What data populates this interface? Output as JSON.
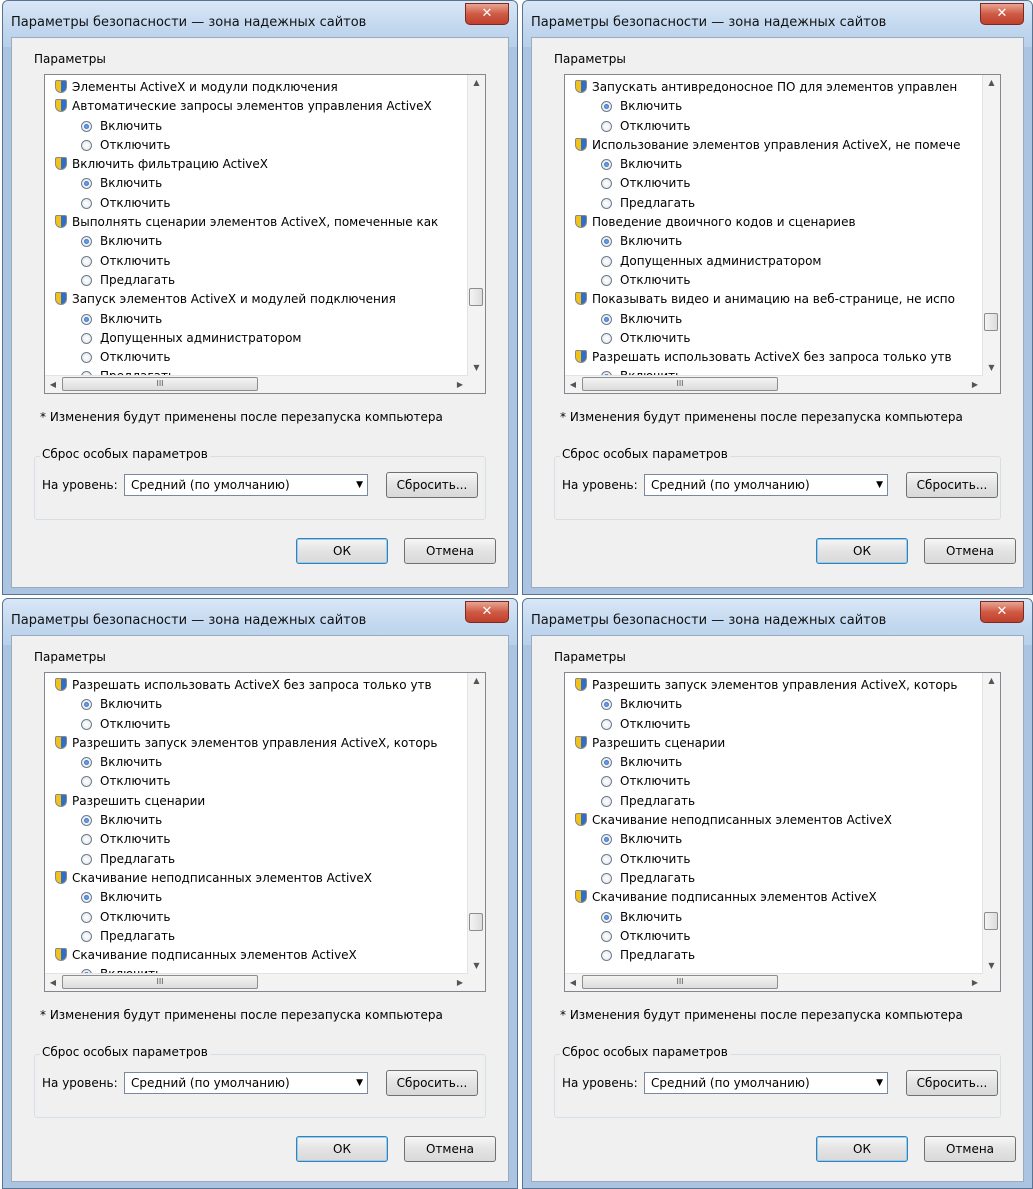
{
  "title": "Параметры безопасности — зона надежных сайтов",
  "close_glyph": "✕",
  "params_label": "Параметры",
  "note": "* Изменения будут применены после перезапуска компьютера",
  "reset_group": "Сброс особых параметров",
  "level_label": "На уровень:",
  "level_value": "Средний (по умолчанию)",
  "reset_button": "Сбросить...",
  "ok_button": "ОК",
  "cancel_button": "Отмена",
  "hscroll_grip": "III",
  "panels": [
    {
      "rows": [
        {
          "t": "h",
          "text": "Элементы ActiveX и модули подключения"
        },
        {
          "t": "h",
          "text": "Автоматические запросы элементов управления ActiveX"
        },
        {
          "t": "o",
          "text": "Включить",
          "on": true
        },
        {
          "t": "o",
          "text": "Отключить",
          "on": false
        },
        {
          "t": "h",
          "text": "Включить фильтрацию ActiveX"
        },
        {
          "t": "o",
          "text": "Включить",
          "on": true
        },
        {
          "t": "o",
          "text": "Отключить",
          "on": false
        },
        {
          "t": "h",
          "text": "Выполнять сценарии элементов ActiveX, помеченные как"
        },
        {
          "t": "o",
          "text": "Включить",
          "on": true
        },
        {
          "t": "o",
          "text": "Отключить",
          "on": false
        },
        {
          "t": "o",
          "text": "Предлагать",
          "on": false
        },
        {
          "t": "h",
          "text": "Запуск элементов ActiveX и модулей подключения"
        },
        {
          "t": "o",
          "text": "Включить",
          "on": true
        },
        {
          "t": "o",
          "text": "Допущенных администратором",
          "on": false
        },
        {
          "t": "o",
          "text": "Отключить",
          "on": false
        },
        {
          "t": "o",
          "text": "Предлагать",
          "on": false
        }
      ]
    },
    {
      "rows": [
        {
          "t": "h",
          "text": "Запускать антивредоносное ПО для элементов управлен"
        },
        {
          "t": "o",
          "text": "Включить",
          "on": true
        },
        {
          "t": "o",
          "text": "Отключить",
          "on": false
        },
        {
          "t": "h",
          "text": "Использование элементов управления ActiveX, не помече"
        },
        {
          "t": "o",
          "text": "Включить",
          "on": true
        },
        {
          "t": "o",
          "text": "Отключить",
          "on": false
        },
        {
          "t": "o",
          "text": "Предлагать",
          "on": false
        },
        {
          "t": "h",
          "text": "Поведение двоичного кодов и сценариев"
        },
        {
          "t": "o",
          "text": "Включить",
          "on": true
        },
        {
          "t": "o",
          "text": "Допущенных администратором",
          "on": false
        },
        {
          "t": "o",
          "text": "Отключить",
          "on": false
        },
        {
          "t": "h",
          "text": "Показывать видео и анимацию на веб-странице, не испо"
        },
        {
          "t": "o",
          "text": "Включить",
          "on": true
        },
        {
          "t": "o",
          "text": "Отключить",
          "on": false
        },
        {
          "t": "h",
          "text": "Разрешать использовать ActiveX без запроса только утв"
        },
        {
          "t": "o",
          "text": "Включить",
          "on": true
        }
      ]
    },
    {
      "rows": [
        {
          "t": "h",
          "text": "Разрешать использовать ActiveX без запроса только утв"
        },
        {
          "t": "o",
          "text": "Включить",
          "on": true
        },
        {
          "t": "o",
          "text": "Отключить",
          "on": false
        },
        {
          "t": "h",
          "text": "Разрешить запуск элементов управления ActiveX, которь"
        },
        {
          "t": "o",
          "text": "Включить",
          "on": true
        },
        {
          "t": "o",
          "text": "Отключить",
          "on": false
        },
        {
          "t": "h",
          "text": "Разрешить сценарии"
        },
        {
          "t": "o",
          "text": "Включить",
          "on": true
        },
        {
          "t": "o",
          "text": "Отключить",
          "on": false
        },
        {
          "t": "o",
          "text": "Предлагать",
          "on": false
        },
        {
          "t": "h",
          "text": "Скачивание неподписанных элементов ActiveX"
        },
        {
          "t": "o",
          "text": "Включить",
          "on": true
        },
        {
          "t": "o",
          "text": "Отключить",
          "on": false
        },
        {
          "t": "o",
          "text": "Предлагать",
          "on": false
        },
        {
          "t": "h",
          "text": "Скачивание подписанных элементов ActiveX"
        },
        {
          "t": "o",
          "text": "Включить",
          "on": true
        }
      ]
    },
    {
      "rows": [
        {
          "t": "h",
          "text": "Разрешить запуск элементов управления ActiveX, которь"
        },
        {
          "t": "o",
          "text": "Включить",
          "on": true
        },
        {
          "t": "o",
          "text": "Отключить",
          "on": false
        },
        {
          "t": "h",
          "text": "Разрешить сценарии"
        },
        {
          "t": "o",
          "text": "Включить",
          "on": true
        },
        {
          "t": "o",
          "text": "Отключить",
          "on": false
        },
        {
          "t": "o",
          "text": "Предлагать",
          "on": false
        },
        {
          "t": "h",
          "text": "Скачивание неподписанных элементов ActiveX"
        },
        {
          "t": "o",
          "text": "Включить",
          "on": true
        },
        {
          "t": "o",
          "text": "Отключить",
          "on": false
        },
        {
          "t": "o",
          "text": "Предлагать",
          "on": false
        },
        {
          "t": "h",
          "text": "Скачивание подписанных элементов ActiveX"
        },
        {
          "t": "o",
          "text": "Включить",
          "on": true
        },
        {
          "t": "o",
          "text": "Отключить",
          "on": false
        },
        {
          "t": "o",
          "text": "Предлагать",
          "on": false
        }
      ]
    }
  ]
}
